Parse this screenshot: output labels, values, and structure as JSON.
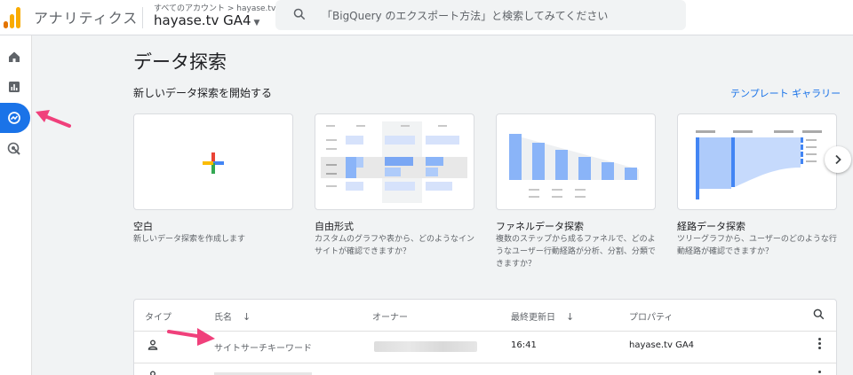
{
  "header": {
    "app_title": "アナリティクス",
    "breadcrumb": "すべてのアカウント > hayase.tv",
    "property_name": "hayase.tv GA4",
    "search_placeholder": "「BigQuery のエクスポート方法」と検索してみてください"
  },
  "nav": {
    "items": [
      "home-icon",
      "reports-icon",
      "explore-icon",
      "advertising-icon"
    ],
    "active": "explore-icon"
  },
  "main": {
    "title": "データ探索",
    "section_title": "新しいデータ探索を開始する",
    "template_gallery": "テンプレート ギャラリー",
    "cards": [
      {
        "label": "空白",
        "desc": "新しいデータ探索を作成します"
      },
      {
        "label": "自由形式",
        "desc": "カスタムのグラフや表から、どのようなインサイトが確認できますか？"
      },
      {
        "label": "ファネルデータ探索",
        "desc": "複数のステップから成るファネルで、どのようなユーザー行動経路が分析、分割、分類できますか？"
      },
      {
        "label": "経路データ探索",
        "desc": "ツリーグラフから、ユーザーのどのような行動経路が確認できますか？"
      }
    ]
  },
  "table": {
    "headers": {
      "type": "タイプ",
      "name": "氏名",
      "owner": "オーナー",
      "updated": "最終更新日",
      "property": "プロパティ"
    },
    "rows": [
      {
        "name": "サイトサーチキーワード",
        "updated": "16:41",
        "property": "hayase.tv GA4"
      }
    ]
  },
  "colors": {
    "accent": "#1a73e8",
    "annotation_arrow": "#f0407b",
    "logo_dark": "#e37400",
    "logo_light": "#f9ab00"
  }
}
